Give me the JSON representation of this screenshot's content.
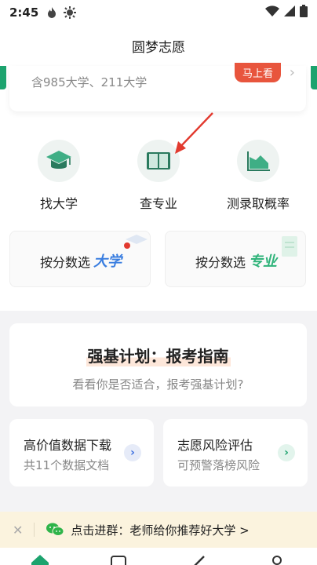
{
  "status_bar": {
    "time": "2:45",
    "icons": [
      "flame-icon",
      "gear-icon",
      "wifi-icon",
      "signal-icon",
      "battery-icon"
    ]
  },
  "header": {
    "title": "圆梦志愿"
  },
  "prev_card": {
    "subtitle": "含985大学、211大学",
    "badge": "马上看"
  },
  "quick_links": [
    {
      "label": "找大学",
      "icon": "graduation-cap-icon"
    },
    {
      "label": "查专业",
      "icon": "book-icon"
    },
    {
      "label": "测录取概率",
      "icon": "area-chart-icon"
    }
  ],
  "score_buttons": [
    {
      "label": "按分数选",
      "tag": "大学"
    },
    {
      "label": "按分数选",
      "tag": "专业"
    }
  ],
  "qiangji": {
    "title": "强基计划：报考指南",
    "subtitle": "看看你是否适合，报考强基计划?"
  },
  "feature_cards": [
    {
      "title": "高价值数据下载",
      "subtitle": "共11个数据文档"
    },
    {
      "title": "志愿风险评估",
      "subtitle": "可预警落榜风险"
    }
  ],
  "banner": {
    "text": "点击进群：老师给你推荐好大学 >"
  },
  "colors": {
    "green": "#1ca36e",
    "red_badge": "#e8553d",
    "blue_tag": "#3a7ee0",
    "green_tag": "#2fb37a",
    "banner_bg": "#fbf3de"
  }
}
